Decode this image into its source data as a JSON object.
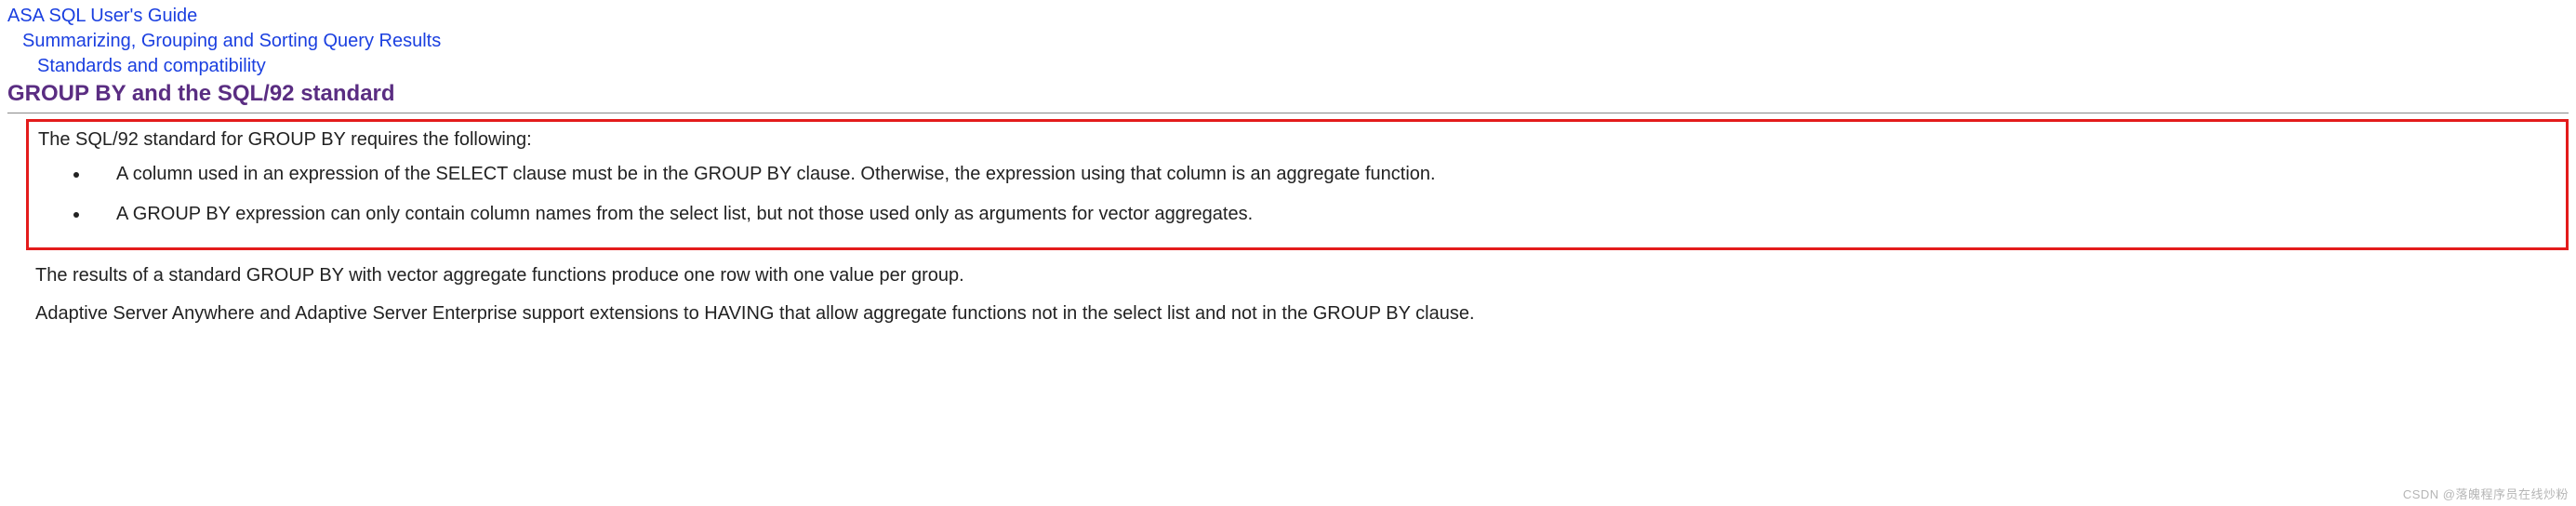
{
  "breadcrumb": {
    "level1": "ASA SQL User's Guide",
    "level2": "Summarizing, Grouping and Sorting Query Results",
    "level3": "Standards and compatibility"
  },
  "page_title": "GROUP BY and the SQL/92 standard",
  "annotation": {
    "highlighted": true,
    "border_color": "#e31b1b"
  },
  "intro_sentence": "The SQL/92 standard for GROUP BY requires the following:",
  "rules": {
    "item1": "A column used in an expression of the SELECT clause must be in the GROUP BY clause. Otherwise, the expression using that column is an aggregate function.",
    "item2": "A GROUP BY expression can only contain column names from the select list, but not those used only as arguments for vector aggregates."
  },
  "paragraph_results": "The results of a standard GROUP BY with vector aggregate functions produce one row with one value per group.",
  "paragraph_extensions": "Adaptive Server Anywhere and Adaptive Server Enterprise support extensions to HAVING that allow aggregate functions not in the select list and not in the GROUP BY clause.",
  "watermark": "CSDN @落魄程序员在线炒粉"
}
